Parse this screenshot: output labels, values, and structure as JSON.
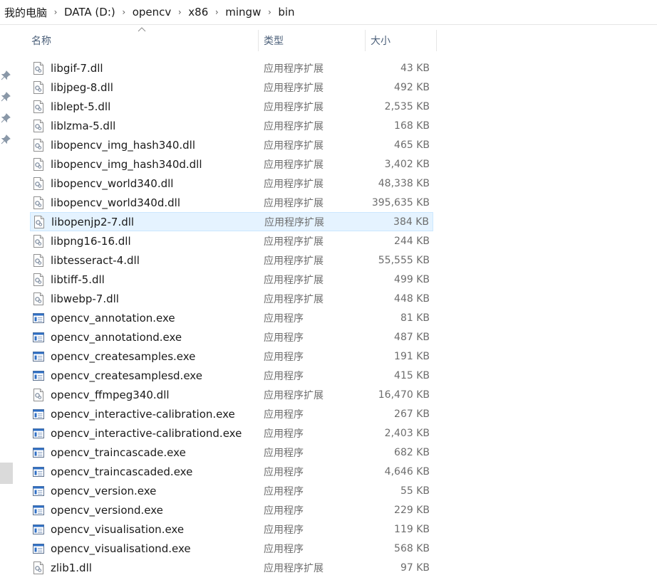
{
  "breadcrumb": [
    "我的电脑",
    "DATA (D:)",
    "opencv",
    "x86",
    "mingw",
    "bin"
  ],
  "columns": {
    "name": "名称",
    "type": "类型",
    "size": "大小"
  },
  "selected_index": 8,
  "files": [
    {
      "name": "libgif-7.dll",
      "type": "应用程序扩展",
      "size": "43 KB",
      "icon": "dll-file-icon"
    },
    {
      "name": "libjpeg-8.dll",
      "type": "应用程序扩展",
      "size": "492 KB",
      "icon": "dll-file-icon"
    },
    {
      "name": "liblept-5.dll",
      "type": "应用程序扩展",
      "size": "2,535 KB",
      "icon": "dll-file-icon"
    },
    {
      "name": "liblzma-5.dll",
      "type": "应用程序扩展",
      "size": "168 KB",
      "icon": "dll-file-icon"
    },
    {
      "name": "libopencv_img_hash340.dll",
      "type": "应用程序扩展",
      "size": "465 KB",
      "icon": "dll-file-icon"
    },
    {
      "name": "libopencv_img_hash340d.dll",
      "type": "应用程序扩展",
      "size": "3,402 KB",
      "icon": "dll-file-icon"
    },
    {
      "name": "libopencv_world340.dll",
      "type": "应用程序扩展",
      "size": "48,338 KB",
      "icon": "dll-file-icon"
    },
    {
      "name": "libopencv_world340d.dll",
      "type": "应用程序扩展",
      "size": "395,635 KB",
      "icon": "dll-file-icon"
    },
    {
      "name": "libopenjp2-7.dll",
      "type": "应用程序扩展",
      "size": "384 KB",
      "icon": "dll-file-icon"
    },
    {
      "name": "libpng16-16.dll",
      "type": "应用程序扩展",
      "size": "244 KB",
      "icon": "dll-file-icon"
    },
    {
      "name": "libtesseract-4.dll",
      "type": "应用程序扩展",
      "size": "55,555 KB",
      "icon": "dll-file-icon"
    },
    {
      "name": "libtiff-5.dll",
      "type": "应用程序扩展",
      "size": "499 KB",
      "icon": "dll-file-icon"
    },
    {
      "name": "libwebp-7.dll",
      "type": "应用程序扩展",
      "size": "448 KB",
      "icon": "dll-file-icon"
    },
    {
      "name": "opencv_annotation.exe",
      "type": "应用程序",
      "size": "81 KB",
      "icon": "exe-file-icon"
    },
    {
      "name": "opencv_annotationd.exe",
      "type": "应用程序",
      "size": "487 KB",
      "icon": "exe-file-icon"
    },
    {
      "name": "opencv_createsamples.exe",
      "type": "应用程序",
      "size": "191 KB",
      "icon": "exe-file-icon"
    },
    {
      "name": "opencv_createsamplesd.exe",
      "type": "应用程序",
      "size": "415 KB",
      "icon": "exe-file-icon"
    },
    {
      "name": "opencv_ffmpeg340.dll",
      "type": "应用程序扩展",
      "size": "16,470 KB",
      "icon": "dll-file-icon"
    },
    {
      "name": "opencv_interactive-calibration.exe",
      "type": "应用程序",
      "size": "267 KB",
      "icon": "exe-file-icon"
    },
    {
      "name": "opencv_interactive-calibrationd.exe",
      "type": "应用程序",
      "size": "2,403 KB",
      "icon": "exe-file-icon"
    },
    {
      "name": "opencv_traincascade.exe",
      "type": "应用程序",
      "size": "682 KB",
      "icon": "exe-file-icon"
    },
    {
      "name": "opencv_traincascaded.exe",
      "type": "应用程序",
      "size": "4,646 KB",
      "icon": "exe-file-icon"
    },
    {
      "name": "opencv_version.exe",
      "type": "应用程序",
      "size": "55 KB",
      "icon": "exe-file-icon"
    },
    {
      "name": "opencv_versiond.exe",
      "type": "应用程序",
      "size": "229 KB",
      "icon": "exe-file-icon"
    },
    {
      "name": "opencv_visualisation.exe",
      "type": "应用程序",
      "size": "119 KB",
      "icon": "exe-file-icon"
    },
    {
      "name": "opencv_visualisationd.exe",
      "type": "应用程序",
      "size": "568 KB",
      "icon": "exe-file-icon"
    },
    {
      "name": "zlib1.dll",
      "type": "应用程序扩展",
      "size": "97 KB",
      "icon": "dll-file-icon"
    }
  ]
}
